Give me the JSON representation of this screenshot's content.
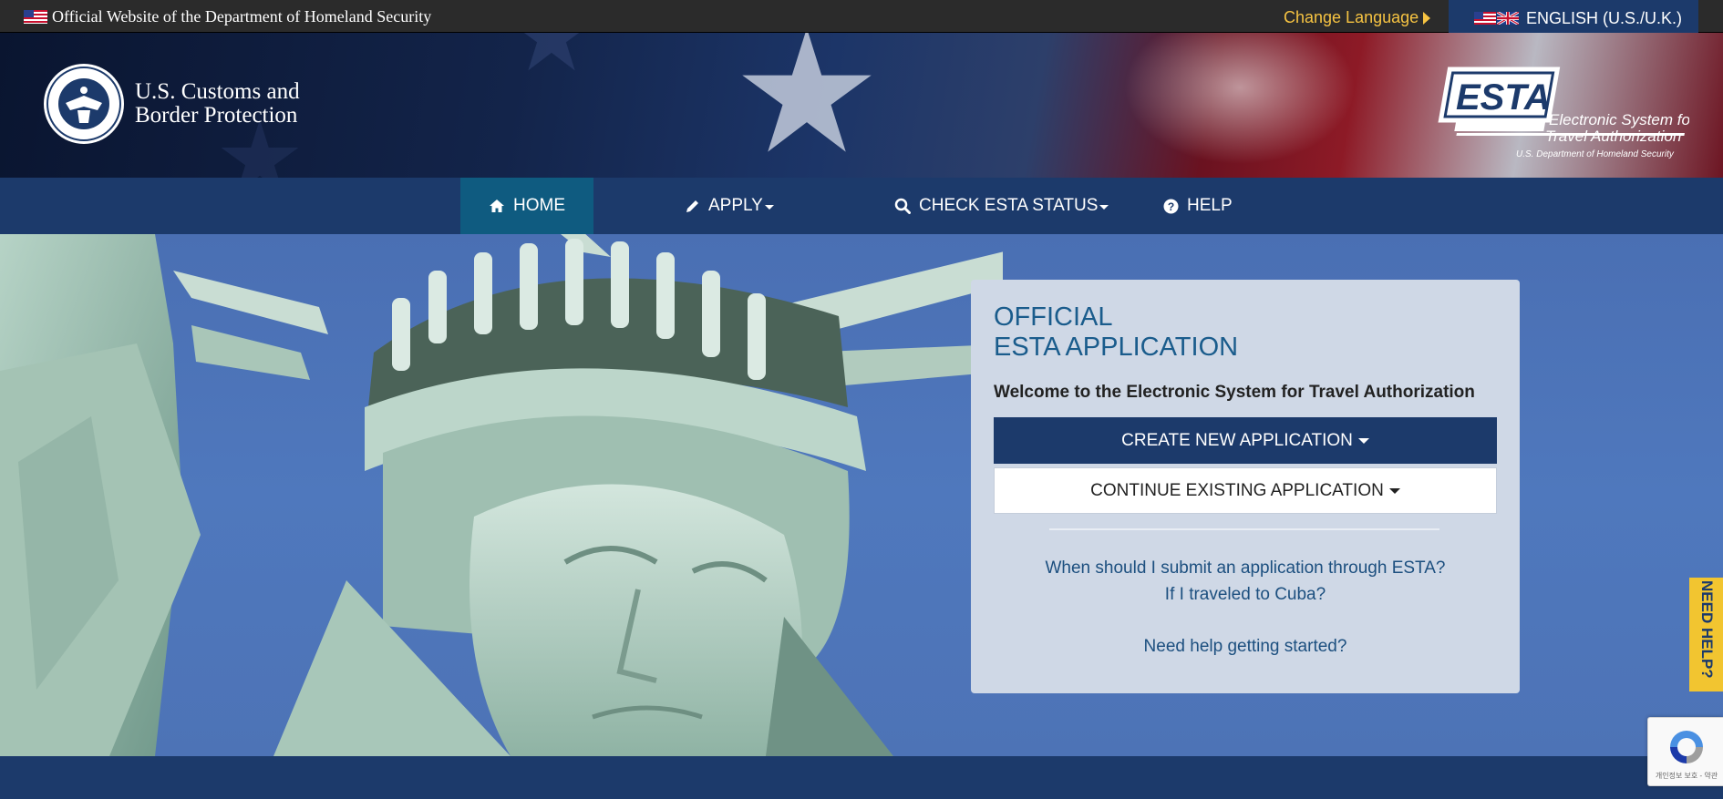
{
  "gov_banner": {
    "text": "Official Website of the Department of Homeland Security",
    "change_language": "Change Language",
    "current_language": "ENGLISH (U.S./U.K.)"
  },
  "header": {
    "agency_line1": "U.S. Customs and",
    "agency_line2": "Border Protection",
    "esta_logo_text": "ESTA",
    "esta_tagline_line1": "Electronic System for",
    "esta_tagline_line2": "Travel Authorization",
    "esta_subline": "U.S. Department of Homeland Security"
  },
  "nav": {
    "items": [
      {
        "label": "HOME",
        "icon": "home-icon",
        "active": true
      },
      {
        "label": "APPLY",
        "icon": "pencil-icon",
        "dropdown": true
      },
      {
        "label": "CHECK ESTA STATUS",
        "icon": "search-icon",
        "dropdown": true
      },
      {
        "label": "HELP",
        "icon": "question-icon"
      }
    ]
  },
  "panel": {
    "title_line1": "OFFICIAL",
    "title_line2": "ESTA APPLICATION",
    "welcome": "Welcome to the Electronic System for Travel Authorization",
    "create_button": "CREATE NEW APPLICATION",
    "continue_button": "CONTINUE EXISTING APPLICATION",
    "links": [
      "When should I submit an application through ESTA?",
      "If I traveled to Cuba?",
      "Need help getting started?"
    ]
  },
  "side_tab": {
    "label": "NEED HELP?"
  },
  "recaptcha": {
    "footer_text": "개인정보 보호 - 약관"
  },
  "colors": {
    "navy": "#1c3a6b",
    "active_nav": "#0f5b80",
    "accent_yellow": "#f2c530",
    "link_blue": "#1c4f7f",
    "panel_bg": "#cfd8e6"
  }
}
